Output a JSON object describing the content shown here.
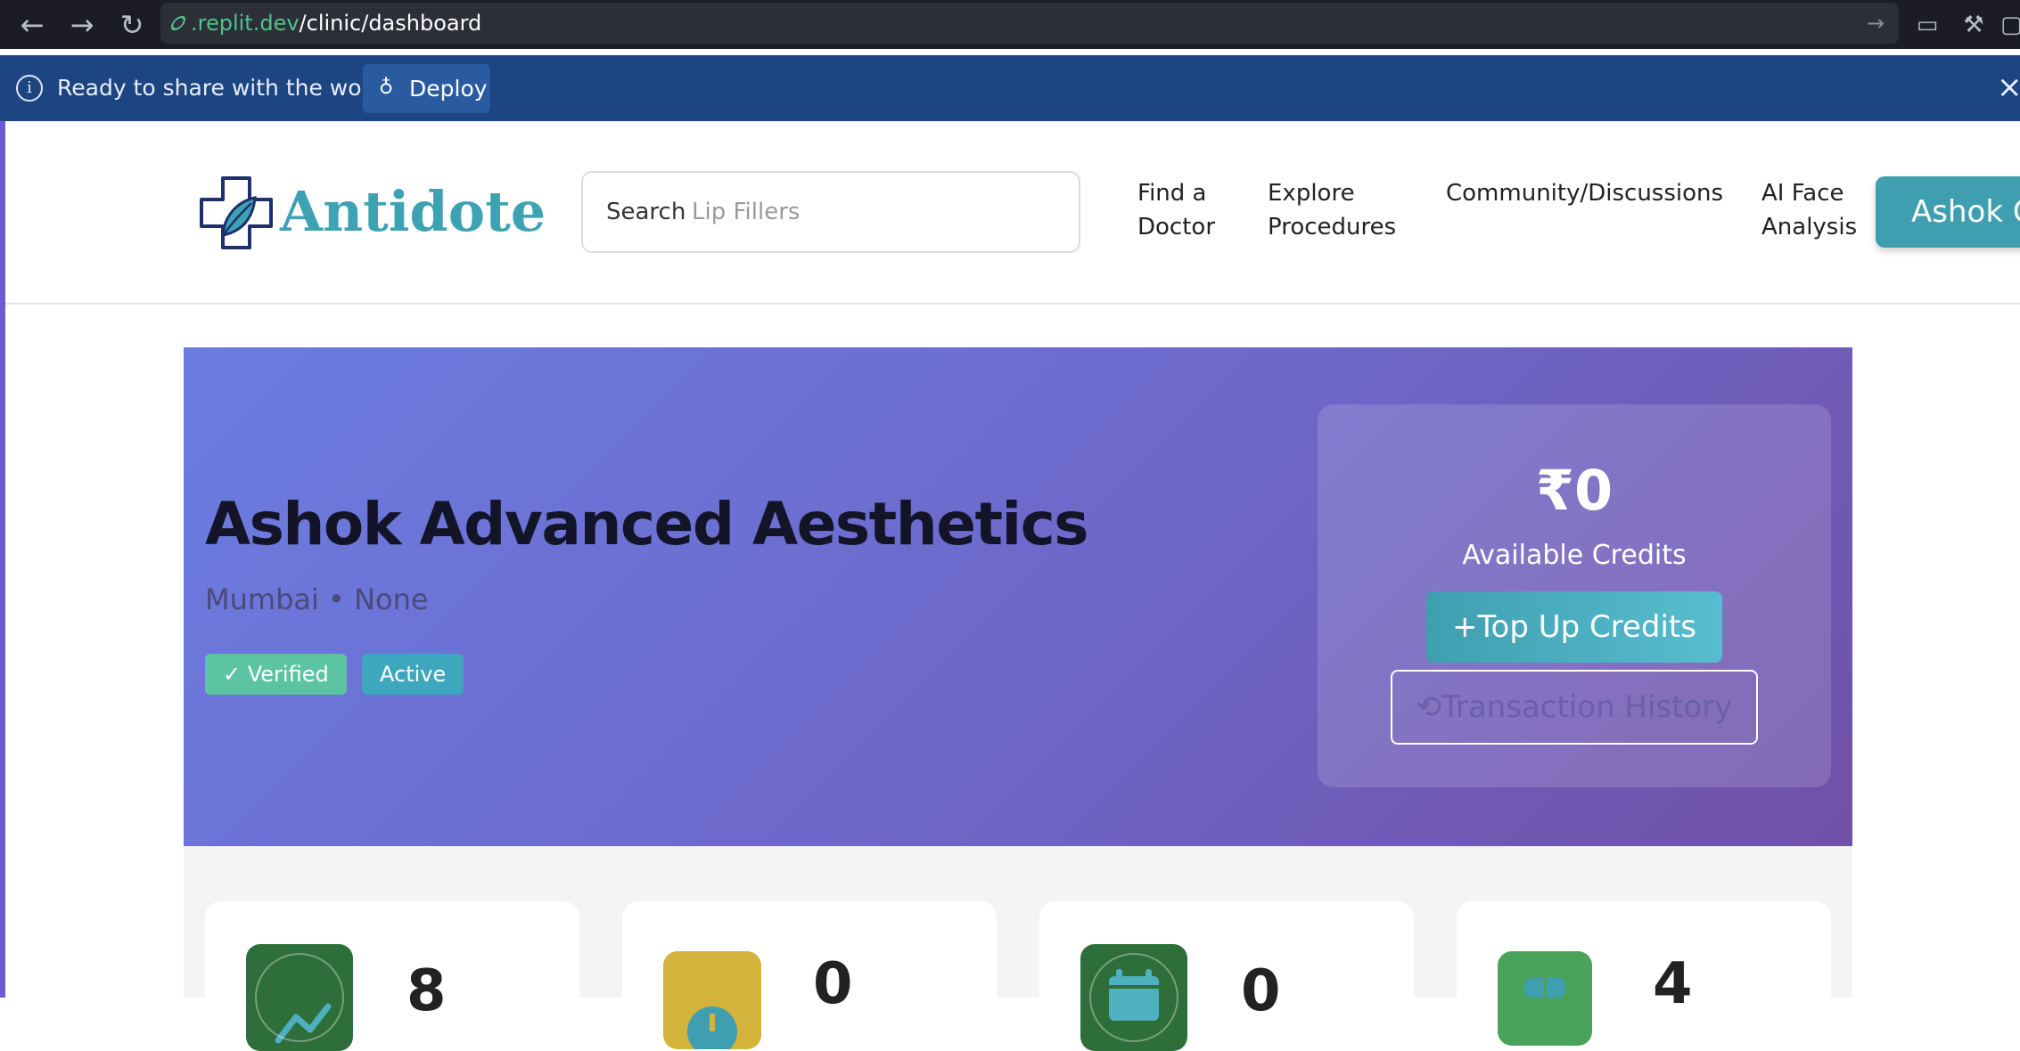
{
  "browser": {
    "url_host": ".replit.dev",
    "url_path": "/clinic/dashboard"
  },
  "deploy_banner": {
    "message": "Ready to share with the world?",
    "button_label": "Deploy"
  },
  "header": {
    "logo_text": "Antidote",
    "search_label": "Search",
    "search_placeholder": "Lip Fillers",
    "nav": {
      "find_doctor_line1": "Find a",
      "find_doctor_line2": "Doctor",
      "explore_line1": "Explore",
      "explore_line2": "Procedures",
      "community": "Community/Discussions",
      "ai_line1": "AI Face",
      "ai_line2": "Analysis"
    },
    "profile_button": "Ashok C"
  },
  "hero": {
    "clinic_name": "Ashok Advanced Aesthetics",
    "clinic_sub": "Mumbai • None",
    "badges": {
      "verified": "✓ Verified",
      "active": "Active"
    },
    "credits": {
      "amount": "₹0",
      "label": "Available Credits",
      "topup": "+Top Up Credits",
      "history": "Transaction History"
    }
  },
  "stats": [
    {
      "value": "8",
      "icon": "chart-line-icon",
      "color": "#2e6e3a"
    },
    {
      "value": "0",
      "icon": "clock-icon",
      "color": "#d4b33c"
    },
    {
      "value": "0",
      "icon": "calendar-icon",
      "color": "#2e6e3a"
    },
    {
      "value": "4",
      "icon": "users-icon",
      "color": "#49a35a"
    }
  ]
}
